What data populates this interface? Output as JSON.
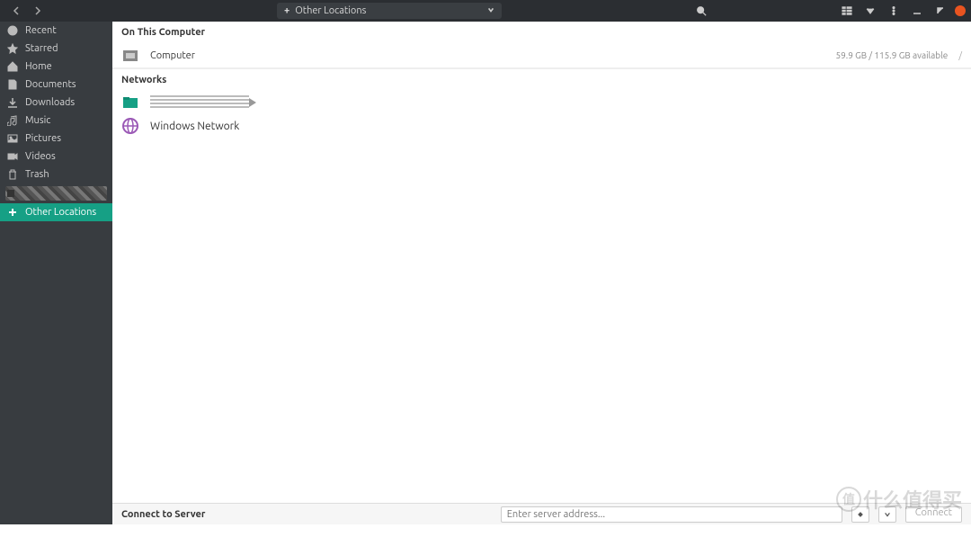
{
  "header": {
    "location_label": "Other Locations"
  },
  "sidebar": {
    "items": [
      {
        "icon": "clock",
        "label": "Recent"
      },
      {
        "icon": "star",
        "label": "Starred"
      },
      {
        "icon": "home",
        "label": "Home"
      },
      {
        "icon": "doc",
        "label": "Documents"
      },
      {
        "icon": "download",
        "label": "Downloads"
      },
      {
        "icon": "music",
        "label": "Music"
      },
      {
        "icon": "picture",
        "label": "Pictures"
      },
      {
        "icon": "video",
        "label": "Videos"
      },
      {
        "icon": "trash",
        "label": "Trash"
      }
    ],
    "other_locations_label": "Other Locations"
  },
  "main": {
    "section1_title": "On This Computer",
    "computer_label": "Computer",
    "storage_text": "59.9 GB / 115.9 GB available",
    "storage_mount": "/",
    "section2_title": "Networks",
    "windows_network_label": "Windows Network"
  },
  "bottom": {
    "label": "Connect to Server",
    "placeholder": "Enter server address...",
    "connect_label": "Connect"
  },
  "watermark": {
    "circle": "值",
    "text": "什么值得买"
  }
}
